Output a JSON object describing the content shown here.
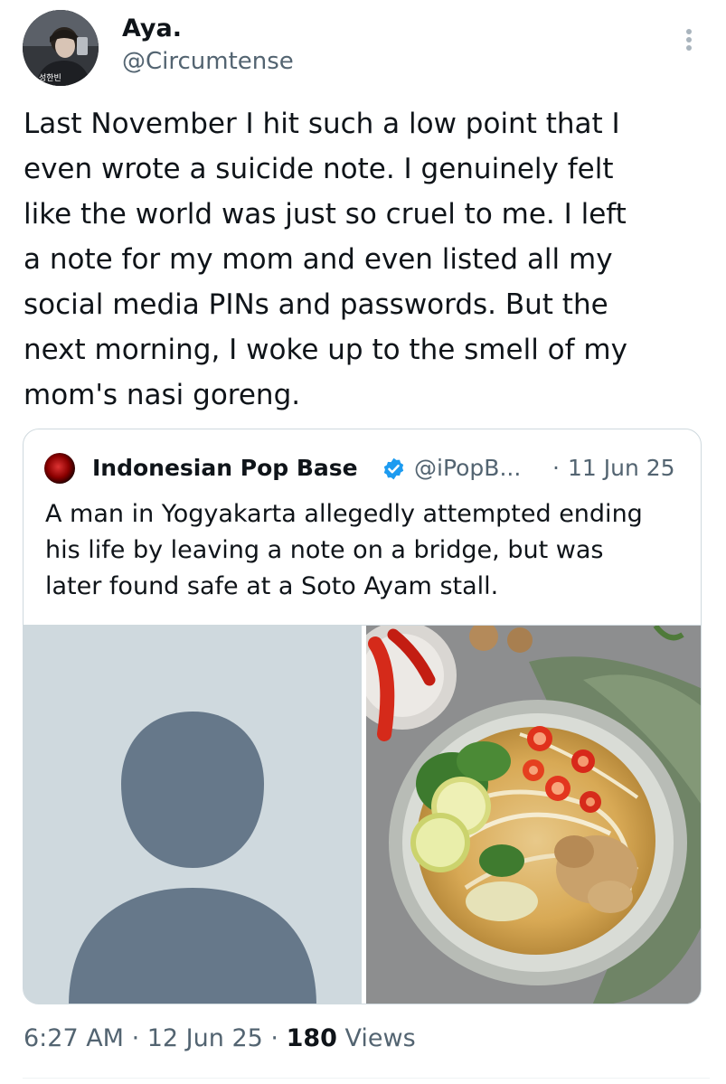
{
  "author": {
    "name": "Aya.",
    "handle": "@Circumtense"
  },
  "tweet": {
    "text": "Last November I hit such a low point that I\neven wrote a suicide note. I genuinely felt\nlike the world was just so cruel to me. I left\na note for my mom and even listed all my\nsocial media PINs and passwords. But the\nnext morning, I woke up to the smell of my\nmom's nasi goreng."
  },
  "quoted": {
    "name": "Indonesian Pop Base",
    "handle": "@iPopB...",
    "separator": "·",
    "date": "11 Jun 25",
    "text": "A man in Yogyakarta allegedly attempted ending\nhis life by leaving a note on a bridge, but was\nlater found safe at a Soto Ayam stall.",
    "verified_color": "#1d9bf0",
    "media": [
      {
        "icon": "default-profile-placeholder-icon"
      },
      {
        "icon": "soto-ayam-bowl-photo"
      }
    ]
  },
  "footer": {
    "time": "6:27 AM",
    "sep1": " · ",
    "date": "12 Jun 25",
    "sep2": " · ",
    "views_count": "180",
    "views_label": " Views"
  },
  "colors": {
    "text": "#0f1419",
    "secondary": "#536471",
    "border": "#cfd9de",
    "accent": "#1d9bf0"
  }
}
